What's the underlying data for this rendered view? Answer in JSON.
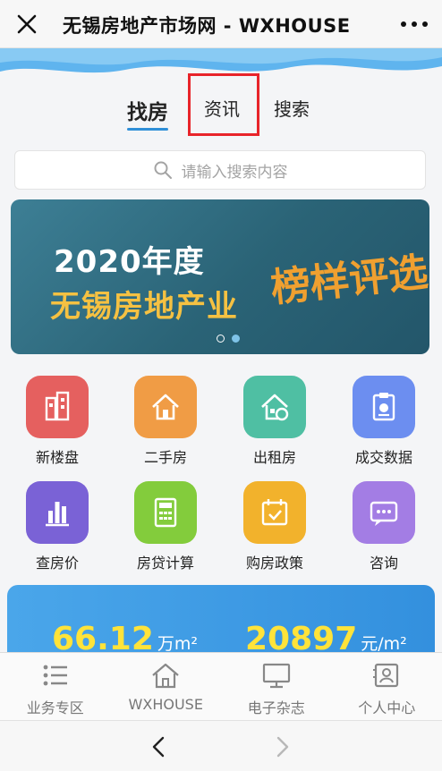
{
  "window": {
    "title": "无锡房地产市场网 - WXHOUSE",
    "close_icon": "close-icon",
    "more_icon": "more-dots-icon"
  },
  "tabs": [
    {
      "label": "找房",
      "active": true
    },
    {
      "label": "资讯",
      "active": false
    },
    {
      "label": "搜索",
      "active": false
    }
  ],
  "search": {
    "placeholder": "请输入搜索内容",
    "icon": "search-icon"
  },
  "banner": {
    "year_text": "2020年度",
    "city_text": "无锡房地产业",
    "award_text": "榜样评选",
    "slide_count": 2,
    "active_slide": 2
  },
  "grid_items": [
    {
      "label": "新楼盘",
      "icon": "buildings-icon",
      "color": "#e5605f"
    },
    {
      "label": "二手房",
      "icon": "house-icon",
      "color": "#f09c45"
    },
    {
      "label": "出租房",
      "icon": "rent-house-icon",
      "color": "#4fbfa3"
    },
    {
      "label": "成交数据",
      "icon": "report-icon",
      "color": "#6c8ef0"
    },
    {
      "label": "查房价",
      "icon": "bar-chart-icon",
      "color": "#7a62d6"
    },
    {
      "label": "房贷计算",
      "icon": "calculator-icon",
      "color": "#83cc3c"
    },
    {
      "label": "购房政策",
      "icon": "calendar-check-icon",
      "color": "#f2b22c"
    },
    {
      "label": "咨询",
      "icon": "chat-icon",
      "color": "#a37de4"
    }
  ],
  "stats": {
    "area_value": "66.12",
    "area_unit": "万m²",
    "price_value": "20897",
    "price_unit": "元/m²"
  },
  "bottom_nav": [
    {
      "label": "业务专区",
      "icon": "list-icon"
    },
    {
      "label": "WXHOUSE",
      "icon": "home-icon"
    },
    {
      "label": "电子杂志",
      "icon": "monitor-icon"
    },
    {
      "label": "个人中心",
      "icon": "id-card-icon"
    }
  ],
  "browser": {
    "back_icon": "back-arrow-icon",
    "forward_icon": "forward-arrow-icon"
  },
  "colors": {
    "accent": "#2f8fd8",
    "highlight_box": "#e8242a",
    "stat_number": "#ffe33a"
  }
}
